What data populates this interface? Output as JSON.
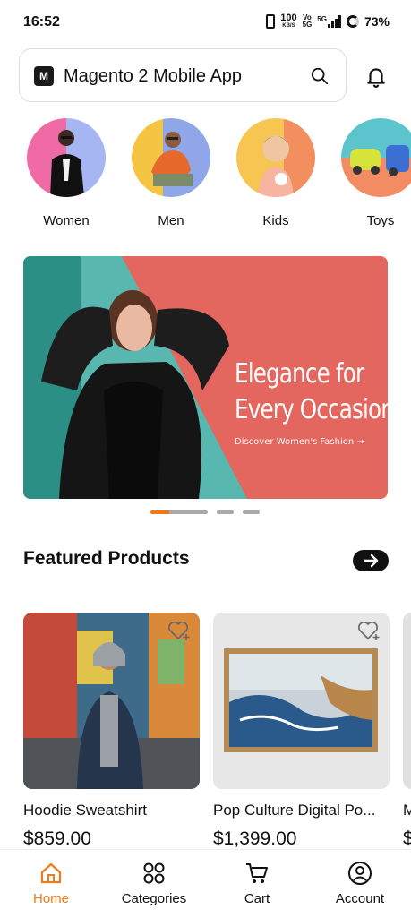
{
  "status_bar": {
    "time": "16:52",
    "net_speed_top": "100",
    "net_speed_bottom": "KB/S",
    "volte_top": "Vo",
    "volte_bottom": "5G",
    "network": "5G",
    "battery": "73%"
  },
  "header": {
    "search_label": "Magento 2 Mobile App",
    "logo_icon": "brand-logo-icon",
    "search_icon": "search-icon",
    "notification_icon": "bell-icon"
  },
  "categories": [
    {
      "label": "Women"
    },
    {
      "label": "Men"
    },
    {
      "label": "Kids"
    },
    {
      "label": "Toys"
    }
  ],
  "banner": {
    "title_line1": "Elegance for",
    "title_line2": "Every Occasion",
    "subtitle": "Discover Women's Fashion →",
    "active_slide": 1,
    "slide_count": 3
  },
  "featured": {
    "title": "Featured Products"
  },
  "products": [
    {
      "name": "Hoodie Sweatshirt",
      "price": "$859.00"
    },
    {
      "name": "Pop Culture Digital Po...",
      "price": "$1,399.00"
    },
    {
      "name": "M",
      "price": "$"
    }
  ],
  "bottom_nav": [
    {
      "label": "Home",
      "icon": "home-icon",
      "active": true
    },
    {
      "label": "Categories",
      "icon": "grid-icon",
      "active": false
    },
    {
      "label": "Cart",
      "icon": "cart-icon",
      "active": false
    },
    {
      "label": "Account",
      "icon": "account-icon",
      "active": false
    }
  ],
  "colors": {
    "accent": "#ee7a1a",
    "banner_bg": "#e3665f",
    "banner_teal": "#58b7ae"
  }
}
